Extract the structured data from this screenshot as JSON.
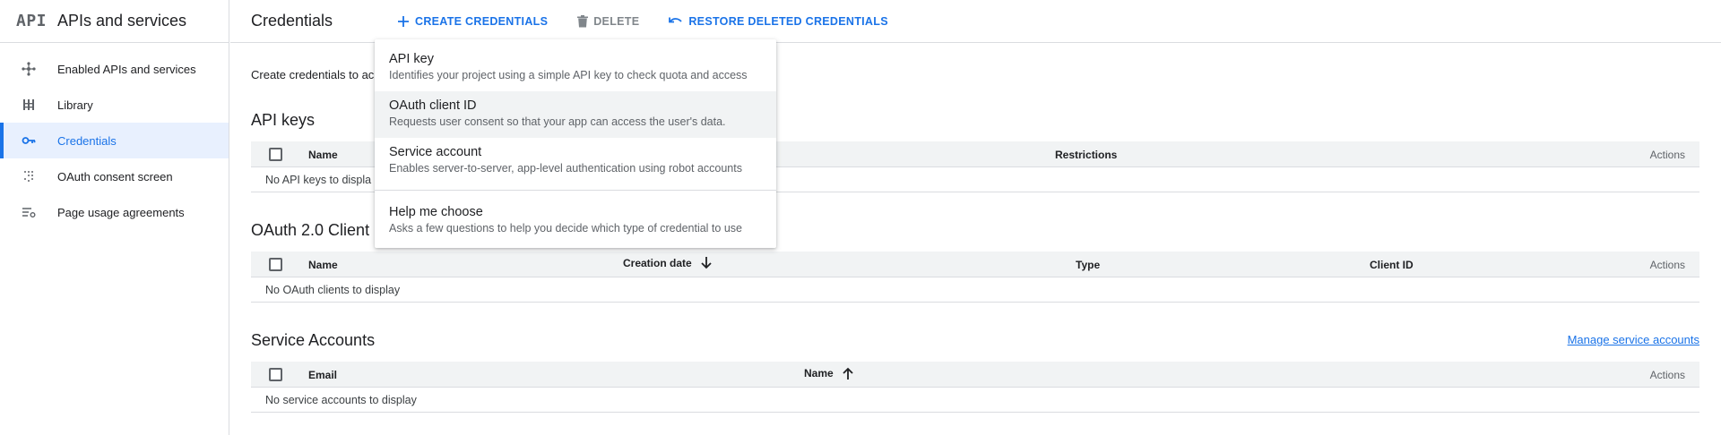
{
  "sidebar": {
    "logo": "API",
    "title": "APIs and services",
    "items": [
      {
        "label": "Enabled APIs and services",
        "icon": "hub-icon"
      },
      {
        "label": "Library",
        "icon": "library-icon"
      },
      {
        "label": "Credentials",
        "icon": "key-icon",
        "active": true
      },
      {
        "label": "OAuth consent screen",
        "icon": "dots-grid-icon"
      },
      {
        "label": "Page usage agreements",
        "icon": "settings-list-icon"
      }
    ]
  },
  "header": {
    "title": "Credentials",
    "create_label": "CREATE CREDENTIALS",
    "delete_label": "DELETE",
    "restore_label": "RESTORE DELETED CREDENTIALS"
  },
  "main": {
    "intro": "Create credentials to ac",
    "api_keys": {
      "title": "API keys",
      "columns": {
        "name": "Name",
        "restrictions": "Restrictions",
        "actions": "Actions"
      },
      "empty": "No API keys to displa"
    },
    "oauth": {
      "title": "OAuth 2.0 Client I",
      "columns": {
        "name": "Name",
        "creation_date": "Creation date",
        "type": "Type",
        "client_id": "Client ID",
        "actions": "Actions"
      },
      "empty": "No OAuth clients to display"
    },
    "service_accounts": {
      "title": "Service Accounts",
      "manage_link": "Manage service accounts",
      "columns": {
        "email": "Email",
        "name": "Name",
        "actions": "Actions"
      },
      "empty": "No service accounts to display"
    }
  },
  "dropdown": {
    "items": [
      {
        "title": "API key",
        "desc": "Identifies your project using a simple API key to check quota and access"
      },
      {
        "title": "OAuth client ID",
        "desc": "Requests user consent so that your app can access the user's data."
      },
      {
        "title": "Service account",
        "desc": "Enables server-to-server, app-level authentication using robot accounts"
      },
      {
        "title": "Help me choose",
        "desc": "Asks a few questions to help you decide which type of credential to use"
      }
    ]
  },
  "colors": {
    "accent": "#1a73e8",
    "active_bg": "#e8f0fe",
    "header_bg": "#f1f3f4"
  }
}
